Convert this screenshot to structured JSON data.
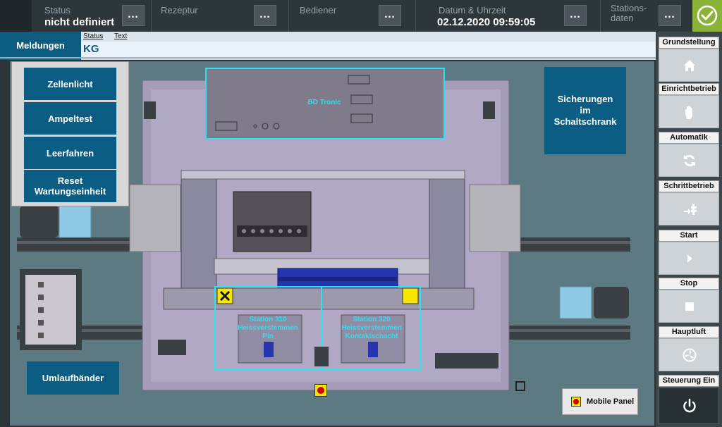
{
  "topbar": {
    "status": {
      "label": "Status",
      "value": "nicht definiert"
    },
    "rezeptur": {
      "label": "Rezeptur",
      "value": ""
    },
    "bediener": {
      "label": "Bediener",
      "value": ""
    },
    "datetime": {
      "label": "Datum & Uhrzeit",
      "value": "02.12.2020 09:59:05"
    },
    "stations": {
      "label": "Stations-\ndaten"
    },
    "more_label": "…"
  },
  "messages": {
    "tab_label": "Meldungen",
    "col_status": "Status",
    "col_text": "Text",
    "row_code": "KG"
  },
  "popup": {
    "buttons": [
      "Zellenlicht",
      "Ampeltest",
      "Leerfahren",
      "Reset\nWartungseinheit"
    ]
  },
  "machine": {
    "bd_tronic": "BD Tronic",
    "station_310": "Station 310\nHeissverstemmen\nPin",
    "station_320": "Station 320\nHeissverstemmen\nKontaktschacht",
    "sicherungen": "Sicherungen\nim\nSchaltschrank",
    "umlaufbaender": "Umlaufbänder",
    "mobile_panel": "Mobile Panel"
  },
  "right_panel": [
    {
      "label": "Grundstellung",
      "icon": "home-icon"
    },
    {
      "label": "Einrichtbetrieb",
      "icon": "hand-icon"
    },
    {
      "label": "Automatik",
      "icon": "refresh-icon"
    },
    {
      "label": "Schrittbetrieb",
      "icon": "step-icon"
    },
    {
      "label": "Start",
      "icon": "play-icon"
    },
    {
      "label": "Stop",
      "icon": "stop-icon"
    },
    {
      "label": "Hauptluft",
      "icon": "fan-icon"
    },
    {
      "label": "Steuerung Ein",
      "icon": "power-icon"
    }
  ],
  "colors": {
    "accent": "#0b5d83",
    "ok": "#8bb33a",
    "highlight": "#2ee0f0",
    "warning": "#f7e600"
  }
}
